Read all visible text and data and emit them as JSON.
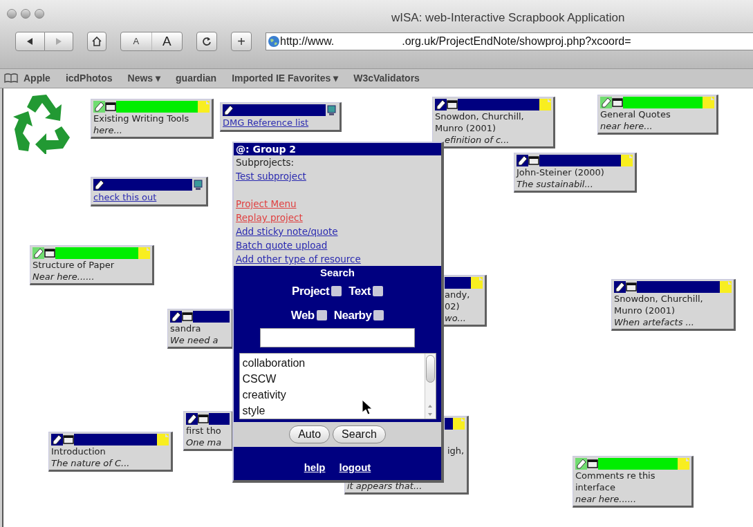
{
  "window": {
    "title": "wISA: web-Interactive Scrapbook Application"
  },
  "toolbar": {
    "text_size_buttons": [
      "A",
      "A"
    ],
    "new_tab_button": "+",
    "url": {
      "before": "http://www.",
      "after": ".org.uk/ProjectEndNote/showproj.php?xcoord="
    }
  },
  "bookmarks": [
    "Apple",
    "icdPhotos",
    "News ▾",
    "guardian",
    "Imported IE Favorites ▾",
    "W3cValidators"
  ],
  "notes": [
    {
      "kind": "note",
      "color": "#00ee00",
      "title": "Existing Writing Tools",
      "subtitle": "here..."
    },
    {
      "kind": "link",
      "color": "#000080",
      "title": "DMG Reference list"
    },
    {
      "kind": "note",
      "color": "#000080",
      "title": "Snowdon, Churchill, Munro (2001)",
      "subtitle": "efinition of c..."
    },
    {
      "kind": "note",
      "color": "#00ee00",
      "title": "General Quotes",
      "subtitle": "near here..."
    },
    {
      "kind": "note",
      "color": "#000080",
      "title": "John-Steiner (2000)",
      "subtitle": "The sustainabil..."
    },
    {
      "kind": "link",
      "color": "#000080",
      "title": "check this out"
    },
    {
      "kind": "note",
      "color": "#00ee00",
      "title": "Structure of Paper",
      "subtitle": "Near here......"
    },
    {
      "kind": "note",
      "color": "#000080",
      "title": "andy, 02)",
      "subtitle": "wo..."
    },
    {
      "kind": "note",
      "color": "#000080",
      "title": "Snowdon, Churchill, Munro (2001)",
      "subtitle": "When artefacts ..."
    },
    {
      "kind": "note",
      "color": "#000080",
      "title": "sandra",
      "subtitle": "We need a"
    },
    {
      "kind": "note",
      "color": "#000080",
      "title": "first tho",
      "subtitle": "One ma"
    },
    {
      "kind": "note",
      "color": "#000080",
      "title": "Introduction",
      "subtitle": "The nature of C..."
    },
    {
      "kind": "note",
      "color": "#000080",
      "title": "igh,",
      "subtitle": "it appears that..."
    },
    {
      "kind": "note",
      "color": "#00ee00",
      "title": "Comments re this interface",
      "subtitle": "near here......"
    }
  ],
  "panel": {
    "title": "@: Group 2",
    "subprojects_label": "Subprojects:",
    "subprojects": [
      "Test subproject"
    ],
    "links": [
      {
        "label": "Project Menu",
        "color": "#e04040"
      },
      {
        "label": "Replay project",
        "color": "#e04040"
      },
      {
        "label": "Add sticky note/quote",
        "color": "#2a2ab0"
      },
      {
        "label": "Batch quote upload",
        "color": "#2a2ab0"
      },
      {
        "label": "Add other type of resource",
        "color": "#2a2ab0"
      }
    ],
    "search": {
      "title": "Search",
      "options": [
        {
          "label": "Project",
          "checked": false
        },
        {
          "label": "Text",
          "checked": false
        },
        {
          "label": "Web",
          "checked": false
        },
        {
          "label": "Nearby",
          "checked": false
        }
      ],
      "list_items": [
        "collaboration",
        "CSCW",
        "creativity",
        "style"
      ],
      "buttons": [
        "Auto",
        "Search"
      ]
    },
    "footer_links": [
      "help",
      "logout"
    ]
  }
}
